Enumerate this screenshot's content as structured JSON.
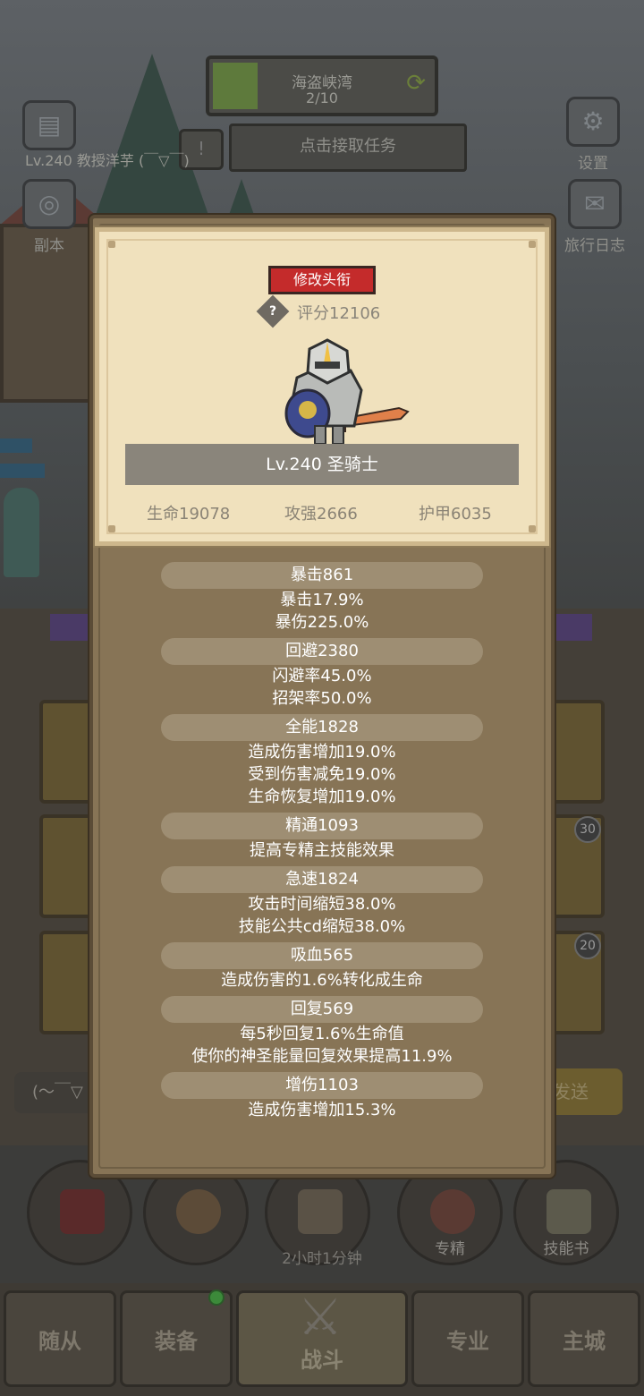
{
  "background": {
    "map": {
      "title": "海盗峡湾",
      "progress": "2/10"
    },
    "quest_button": "点击接取任务",
    "player_line": "Lv.240 教授洋芋 (￣▽￣)",
    "side_buttons": {
      "settings": "设置",
      "dungeon": "副本",
      "travel_log": "旅行日志"
    },
    "tile_badges": [
      "30",
      "20"
    ],
    "chat_placeholder": "(～￣▽",
    "send_button": "发送",
    "circle_buttons": {
      "specialization": "专精",
      "skill_book": "技能书"
    },
    "timer": "2小时1分钟"
  },
  "bottom_nav": {
    "tabs": [
      "随从",
      "装备",
      "战斗",
      "专业",
      "主城"
    ]
  },
  "profile": {
    "change_title_button": "修改头衔",
    "score": "评分12106",
    "name": "Lv.240 圣骑士",
    "base_stats": {
      "hp": "生命19078",
      "attack": "攻强2666",
      "armor": "护甲6035"
    }
  },
  "stats": [
    {
      "header": "暴击861",
      "lines": [
        "暴击17.9%",
        "暴伤225.0%"
      ]
    },
    {
      "header": "回避2380",
      "lines": [
        "闪避率45.0%",
        "招架率50.0%"
      ]
    },
    {
      "header": "全能1828",
      "lines": [
        "造成伤害增加19.0%",
        "受到伤害减免19.0%",
        "生命恢复增加19.0%"
      ]
    },
    {
      "header": "精通1093",
      "lines": [
        "提高专精主技能效果"
      ]
    },
    {
      "header": "急速1824",
      "lines": [
        "攻击时间缩短38.0%",
        "技能公共cd缩短38.0%"
      ]
    },
    {
      "header": "吸血565",
      "lines": [
        "造成伤害的1.6%转化成生命"
      ]
    },
    {
      "header": "回复569",
      "lines": [
        "每5秒回复1.6%生命值",
        "使你的神圣能量回复效果提高11.9%"
      ]
    },
    {
      "header": "增伤1103",
      "lines": [
        "造成伤害增加15.3%"
      ]
    }
  ],
  "colors": {
    "title_button": "#c42b2b",
    "card_bg": "#f0e1bd",
    "panel_bg": "#877456",
    "stat_pill": "#9e8e73"
  }
}
